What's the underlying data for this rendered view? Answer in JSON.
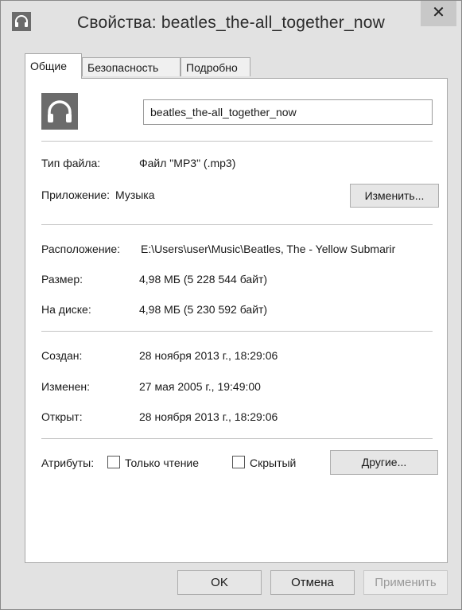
{
  "window": {
    "title": "Свойства: beatles_the-all_together_now",
    "close_glyph": "✕"
  },
  "tabs": [
    {
      "label": "Общие",
      "active": true
    },
    {
      "label": "Безопасность",
      "active": false
    },
    {
      "label": "Подробно",
      "active": false
    }
  ],
  "general": {
    "file_name": "beatles_the-all_together_now",
    "file_icon": "headphones-icon",
    "file_type_label": "Тип файла:",
    "file_type_value": "Файл \"MP3\" (.mp3)",
    "app_label": "Приложение:",
    "app_value": "Музыка",
    "change_button": "Изменить...",
    "location_label": "Расположение:",
    "location_value": "E:\\Users\\user\\Music\\Beatles, The - Yellow Submarir",
    "size_label": "Размер:",
    "size_value": "4,98 МБ (5 228 544 байт)",
    "disk_label": "На диске:",
    "disk_value": "4,98 МБ (5 230 592 байт)",
    "created_label": "Создан:",
    "created_value": "28 ноября 2013 г., 18:29:06",
    "modified_label": "Изменен:",
    "modified_value": "27 мая 2005 г., 19:49:00",
    "opened_label": "Открыт:",
    "opened_value": "28 ноября 2013 г., 18:29:06",
    "attributes_label": "Атрибуты:",
    "readonly_label": "Только чтение",
    "readonly_checked": false,
    "hidden_label": "Скрытый",
    "hidden_checked": false,
    "other_button": "Другие..."
  },
  "footer": {
    "ok": "OK",
    "cancel": "Отмена",
    "apply": "Применить"
  }
}
